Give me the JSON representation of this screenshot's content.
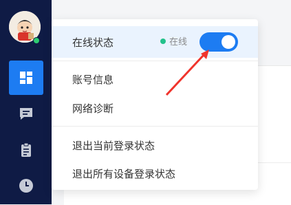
{
  "menu": {
    "online_status_label": "在线状态",
    "online_status_value": "在线",
    "online_toggle_on": true,
    "account_info": "账号信息",
    "network_diagnosis": "网络诊断",
    "logout_current": "退出当前登录状态",
    "logout_all": "退出所有设备登录状态"
  },
  "colors": {
    "sidebar_bg": "#0f1b45",
    "accent": "#1d7cf2",
    "online_green": "#23c18b",
    "annotation_arrow": "#f0342c"
  },
  "sidebar": {
    "items": [
      "dashboard-icon",
      "chat-icon",
      "clipboard-icon",
      "clock-icon"
    ],
    "active_index": 0
  }
}
